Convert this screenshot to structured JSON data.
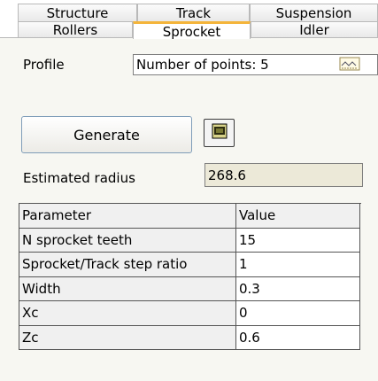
{
  "tabs_row1": [
    "Structure",
    "Track",
    "Suspension"
  ],
  "tabs_row2": [
    "Rollers",
    "Sprocket",
    "Idler"
  ],
  "profile": {
    "label": "Profile",
    "value": "Number of points: 5"
  },
  "buttons": {
    "generate": "Generate"
  },
  "estimated_radius": {
    "label": "Estimated radius",
    "value": "268.6"
  },
  "table": {
    "headers": [
      "Parameter",
      "Value"
    ],
    "rows": [
      [
        "N sprocket teeth",
        "15"
      ],
      [
        "Sprocket/Track step ratio",
        "1"
      ],
      [
        "Width",
        "0.3"
      ],
      [
        "Xc",
        "0"
      ],
      [
        "Zc",
        "0.6"
      ]
    ]
  },
  "colors": {
    "active_tab_accent": "#f4b43a",
    "panel_bg": "#f7f7f2"
  }
}
